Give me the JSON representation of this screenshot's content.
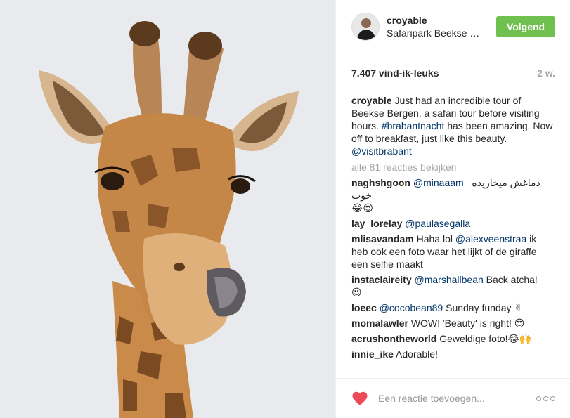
{
  "post": {
    "username": "croyable",
    "location": "Safaripark Beekse Bergen",
    "follow_label": "Volgend",
    "likes": "7.407 vind-ik-leuks",
    "time_ago": "2 w.",
    "caption_user": "croyable",
    "caption_text_1": " Just had an incredible tour of Beekse Bergen, a safari tour before visiting hours. ",
    "caption_hashtag": "#brabantnacht",
    "caption_text_2": " has been amazing. Now off to breakfast, just like this beauty. ",
    "caption_mention": "@visitbrabant",
    "view_all": "alle 81 reacties bekijken"
  },
  "comments": [
    {
      "user": "naghshgoon",
      "mention": "@minaaam_",
      "text": " دماغش میخاریده خوب",
      "emoji": "😂😍"
    },
    {
      "user": "lay_lorelay",
      "mention": "@paulasegalla",
      "text": "",
      "emoji": ""
    },
    {
      "user": "mlisavandam",
      "pre": " Haha lol ",
      "mention": "@alexveenstraa",
      "text": " ik heb ook een foto waar het lijkt of de giraffe een selfie maakt",
      "emoji": ""
    },
    {
      "user": "instaclaireity",
      "mention": "@marshallbean",
      "text": " Back atcha! ",
      "emoji": "😉"
    },
    {
      "user": "loeec",
      "mention": "@cocobean89",
      "text": " Sunday funday ",
      "emoji": "✌"
    },
    {
      "user": "momalawler",
      "mention": "",
      "text": " WOW! 'Beauty' is right! ",
      "emoji": "😍"
    },
    {
      "user": "acrushontheworld",
      "mention": "",
      "text": " Geweldige foto!",
      "emoji": "😂🙌"
    },
    {
      "user": "innie_ike",
      "mention": "",
      "text": " Adorable!",
      "emoji": ""
    }
  ],
  "footer": {
    "placeholder": "Een reactie toevoegen...",
    "heart_icon": "heart-icon",
    "more_icon": "more-options-icon"
  },
  "colors": {
    "follow_bg": "#70c050",
    "link": "#003569",
    "heart": "#ed4956",
    "muted": "#a5a7aa"
  }
}
